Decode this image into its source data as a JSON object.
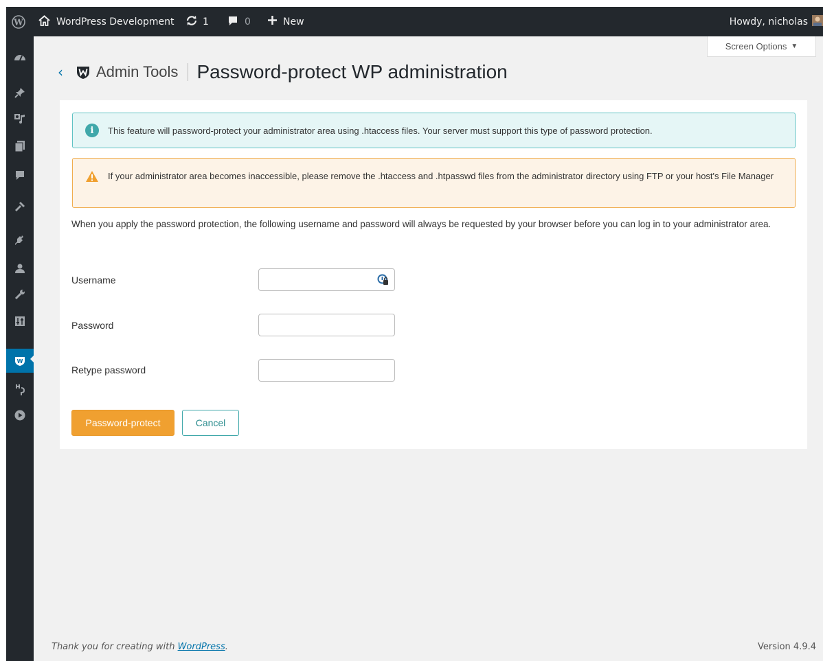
{
  "adminbar": {
    "site_name": "WordPress Development",
    "updates_count": "1",
    "comments_count": "0",
    "new_label": "New",
    "howdy": "Howdy, nicholas"
  },
  "screen_options": {
    "label": "Screen Options",
    "arrow": "▼"
  },
  "header": {
    "back_symbol": "‹",
    "brand": "Admin Tools",
    "title": "Password-protect WP administration"
  },
  "alerts": {
    "info": "This feature will password-protect your administrator area using .htaccess files. Your server must support this type of password protection.",
    "warning": "If your administrator area becomes inaccessible, please remove the .htaccess and .htpasswd files from the administrator directory using FTP or your host's File Manager"
  },
  "description": "When you apply the password protection, the following username and password will always be requested by your browser before you can log in to your administrator area.",
  "form": {
    "username_label": "Username",
    "username_value": "",
    "password_label": "Password",
    "password_value": "",
    "retype_label": "Retype password",
    "retype_value": ""
  },
  "buttons": {
    "submit": "Password-protect",
    "cancel": "Cancel"
  },
  "footer": {
    "thanks_prefix": "Thank you for creating with ",
    "thanks_link": "WordPress",
    "thanks_suffix": ".",
    "version": "Version 4.9.4"
  },
  "sidebar_icons": [
    "dashboard-icon",
    "pin-icon",
    "media-icon",
    "pages-icon",
    "comments-icon",
    "appearance-icon",
    "plugins-icon",
    "users-icon",
    "tools-icon",
    "settings-icon",
    "admin-tools-icon",
    "plugin-extra-icon",
    "play-icon"
  ],
  "colors": {
    "adminbar_bg": "#23282d",
    "active_menu": "#0073aa",
    "info_border": "#5fc2c4",
    "warning_border": "#f0ad4e",
    "primary_button": "#f0a030",
    "cancel_border": "#40a8aa"
  }
}
